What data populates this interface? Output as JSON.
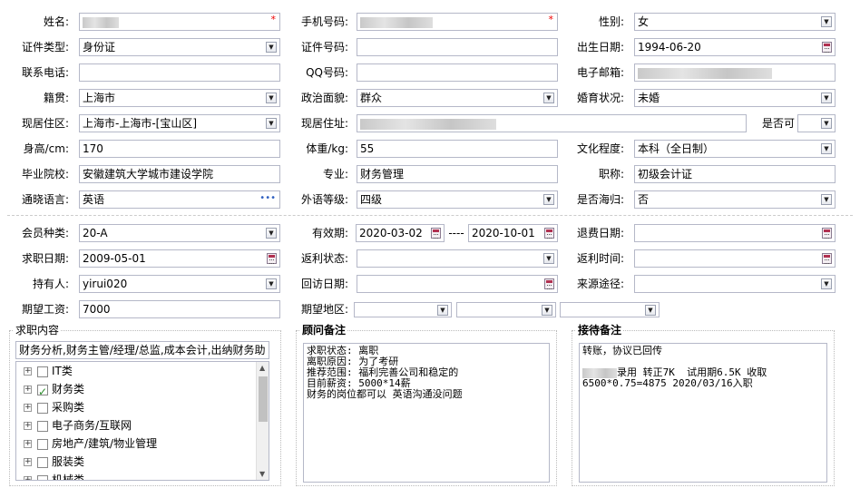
{
  "personal": {
    "name_label": "姓名:",
    "phone_label": "手机号码:",
    "gender_label": "性别:",
    "gender_value": "女",
    "id_type_label": "证件类型:",
    "id_type_value": "身份证",
    "id_no_label": "证件号码:",
    "birth_label": "出生日期:",
    "birth_value": "1994-06-20",
    "contact_label": "联系电话:",
    "qq_label": "QQ号码:",
    "email_label": "电子邮箱:",
    "native_label": "籍贯:",
    "native_value": "上海市",
    "political_label": "政治面貌:",
    "political_value": "群众",
    "marital_label": "婚育状况:",
    "marital_value": "未婚",
    "region_label": "现居住区:",
    "region_value": "上海市-上海市-[宝山区]",
    "address_label": "现居住址:",
    "yesno_label": "是否可",
    "height_label": "身高/cm:",
    "height_value": "170",
    "weight_label": "体重/kg:",
    "weight_value": "55",
    "edu_label": "文化程度:",
    "edu_value": "本科（全日制）",
    "school_label": "毕业院校:",
    "school_value": "安徽建筑大学城市建设学院",
    "major_label": "专业:",
    "major_value": "财务管理",
    "title_label": "职称:",
    "title_value": "初级会计证",
    "lang_label": "通晓语言:",
    "lang_value": "英语",
    "lang_more": "•••",
    "lang_level_label": "外语等级:",
    "lang_level_value": "四级",
    "overseas_label": "是否海归:",
    "overseas_value": "否"
  },
  "membership": {
    "type_label": "会员种类:",
    "type_value": "20-A",
    "valid_label": "有效期:",
    "valid_from": "2020-03-02",
    "valid_sep": "----",
    "valid_to": "2020-10-01",
    "refund_label": "退费日期:",
    "job_date_label": "求职日期:",
    "job_date_value": "2009-05-01",
    "return_status_label": "返利状态:",
    "return_time_label": "返利时间:",
    "holder_label": "持有人:",
    "holder_value": "yirui020",
    "visit_label": "回访日期:",
    "source_label": "来源途径:",
    "salary_label": "期望工资:",
    "salary_value": "7000",
    "area_label": "期望地区:"
  },
  "job_content": {
    "title": "求职内容",
    "summary": "财务分析,财务主管/经理/总监,成本会计,出纳财务助",
    "tree": [
      {
        "label": "IT类",
        "checked": false
      },
      {
        "label": "财务类",
        "checked": true
      },
      {
        "label": "采购类",
        "checked": false
      },
      {
        "label": "电子商务/互联网",
        "checked": false
      },
      {
        "label": "房地产/建筑/物业管理",
        "checked": false
      },
      {
        "label": "服装类",
        "checked": false
      },
      {
        "label": "机械类",
        "checked": false
      }
    ]
  },
  "consultant": {
    "title": "顾问备注",
    "notes": "求职状态: 离职\n离职原因: 为了考研\n推荐范围: 福利完善公司和稳定的\n目前薪资: 5000*14薪\n财务的岗位都可以 英语沟通没问题"
  },
  "reception": {
    "title": "接待备注",
    "line1": "转账，协议已回传",
    "line2": "录用 转正7K  试用期6.5K 收取",
    "line3": "6500*0.75=4875 2020/03/16入职"
  },
  "colors": {
    "required": "#e00000",
    "field_border": "#b5b8c8",
    "check": "#2a8a2a"
  }
}
